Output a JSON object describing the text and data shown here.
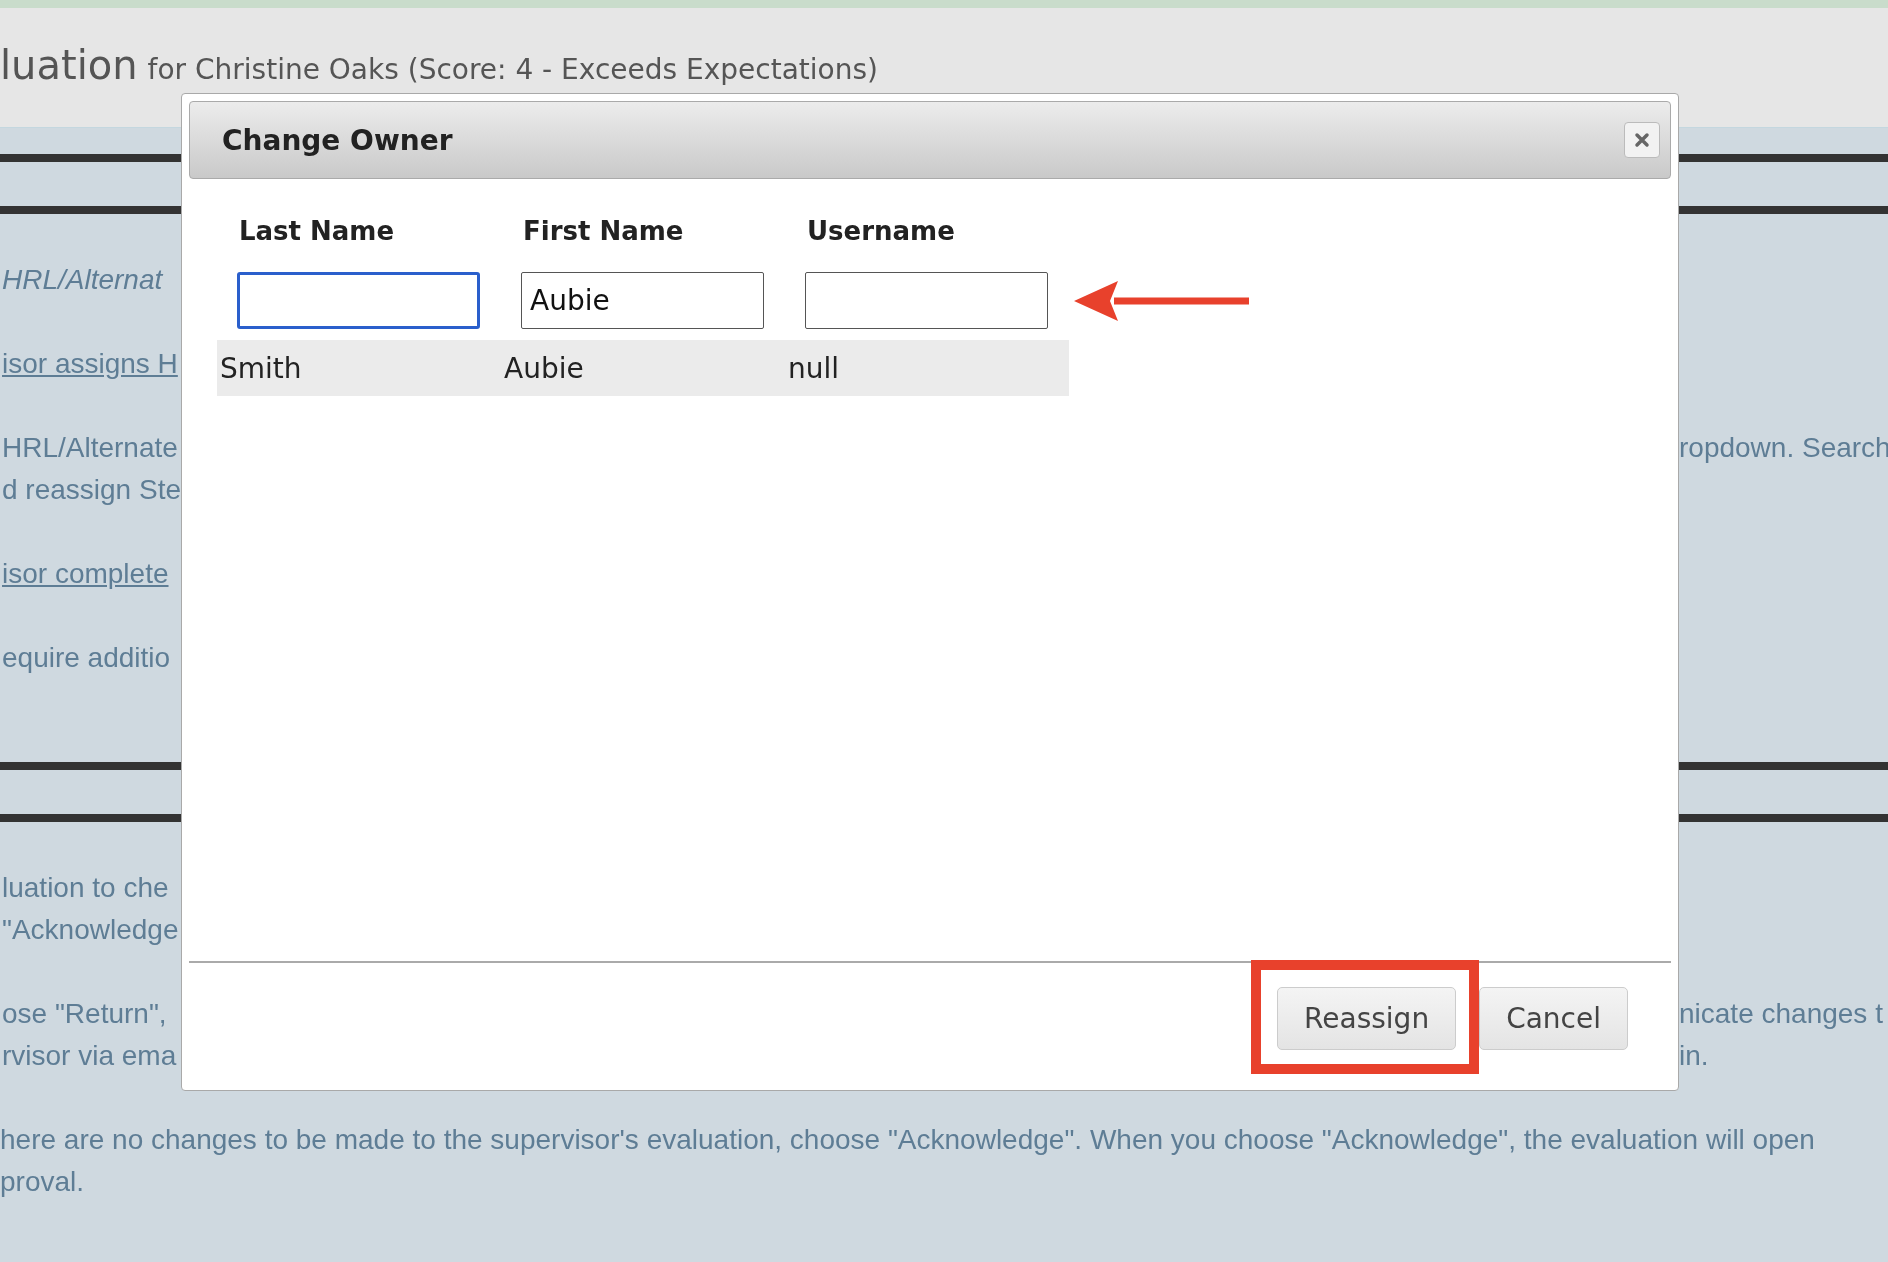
{
  "header": {
    "title": "luation",
    "subtitle": "for Christine Oaks (Score: 4 - Exceeds Expectations)"
  },
  "background": {
    "sections": [
      {
        "paragraphs": [
          {
            "lines": [
              {
                "kind": "italic",
                "left": "HRL/Alternat"
              }
            ]
          },
          {
            "lines": [
              {
                "kind": "link",
                "left": "isor assigns H"
              }
            ]
          },
          {
            "lines": [
              {
                "kind": "text",
                "left": "HRL/Alternate",
                "right": "ropdown. Search"
              },
              {
                "kind": "text",
                "left": "d reassign Ste"
              }
            ]
          },
          {
            "lines": [
              {
                "kind": "link",
                "left": "isor complete"
              }
            ]
          },
          {
            "lines": [
              {
                "kind": "text",
                "left": "equire additio"
              }
            ]
          }
        ]
      },
      {
        "paragraphs": [
          {
            "lines": [
              {
                "kind": "text",
                "left": "luation to che"
              },
              {
                "kind": "text",
                "left": "\"Acknowledge"
              }
            ]
          },
          {
            "lines": [
              {
                "kind": "text",
                "left": "ose \"Return\",",
                "right": "nicate changes t"
              },
              {
                "kind": "text",
                "left": "rvisor via ema",
                "right": "in."
              }
            ]
          },
          {
            "lines": [
              {
                "kind": "full",
                "left": "here are no changes to be made to the supervisor's evaluation, choose \"Acknowledge\". When you choose \"Acknowledge\", the evaluation will open"
              },
              {
                "kind": "full",
                "left": "proval."
              }
            ]
          }
        ]
      }
    ]
  },
  "dialog": {
    "title": "Change Owner",
    "columns": [
      "Last Name",
      "First Name",
      "Username"
    ],
    "fields": [
      {
        "focused": true
      },
      {
        "value": "Aubie",
        "focused": false
      },
      {
        "focused": false
      }
    ],
    "pointer_arrow": true,
    "results": [
      {
        "cells": [
          "Smith",
          "Aubie",
          "null"
        ]
      }
    ],
    "buttons": [
      {
        "label": "Reassign",
        "highlighted": true
      },
      {
        "label": "Cancel",
        "highlighted": false
      }
    ]
  }
}
